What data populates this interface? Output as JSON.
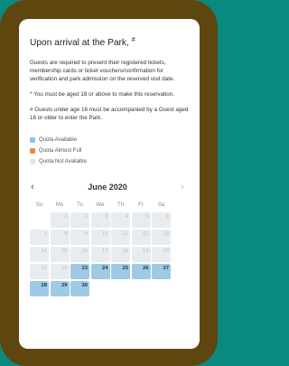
{
  "section": {
    "heading": "Upon arrival at the Park,",
    "heading_marker": "#",
    "paragraphs": [
      "Guests are required to present their registered tickets, membership cards or ticket vouchers/confirmation for verification and park admission on the reserved visit date.",
      "* You must be aged 18 or above to make this reservation.",
      "# Guests under age 16 must be accompanied by a Guest aged 16 or older to enter the Park."
    ]
  },
  "legend": [
    {
      "label": "Quota Available",
      "color": "#8fc2e3"
    },
    {
      "label": "Quota Almost Full",
      "color": "#f0883a"
    },
    {
      "label": "Quota Not Available",
      "color": "#dbe8f0"
    }
  ],
  "calendar": {
    "month_label": "June 2020",
    "prev_icon": "‹",
    "next_icon": "›",
    "weekdays": [
      "Su",
      "Mo",
      "Tu",
      "We",
      "Th",
      "Fr",
      "Sa"
    ],
    "first_weekday_index": 1,
    "days": [
      {
        "d": "1",
        "s": "past"
      },
      {
        "d": "2",
        "s": "past"
      },
      {
        "d": "3",
        "s": "past"
      },
      {
        "d": "4",
        "s": "past"
      },
      {
        "d": "5",
        "s": "past"
      },
      {
        "d": "6",
        "s": "past"
      },
      {
        "d": "7",
        "s": "past"
      },
      {
        "d": "8",
        "s": "past"
      },
      {
        "d": "9",
        "s": "past"
      },
      {
        "d": "10",
        "s": "past"
      },
      {
        "d": "11",
        "s": "past"
      },
      {
        "d": "12",
        "s": "past"
      },
      {
        "d": "13",
        "s": "past"
      },
      {
        "d": "14",
        "s": "past"
      },
      {
        "d": "15",
        "s": "past"
      },
      {
        "d": "16",
        "s": "past"
      },
      {
        "d": "17",
        "s": "past"
      },
      {
        "d": "18",
        "s": "past"
      },
      {
        "d": "19",
        "s": "past"
      },
      {
        "d": "20",
        "s": "past"
      },
      {
        "d": "21",
        "s": "past"
      },
      {
        "d": "22",
        "s": "past"
      },
      {
        "d": "23",
        "s": "avail"
      },
      {
        "d": "24",
        "s": "avail"
      },
      {
        "d": "25",
        "s": "avail"
      },
      {
        "d": "26",
        "s": "avail"
      },
      {
        "d": "27",
        "s": "avail"
      },
      {
        "d": "28",
        "s": "avail"
      },
      {
        "d": "29",
        "s": "avail"
      },
      {
        "d": "30",
        "s": "avail"
      }
    ]
  }
}
